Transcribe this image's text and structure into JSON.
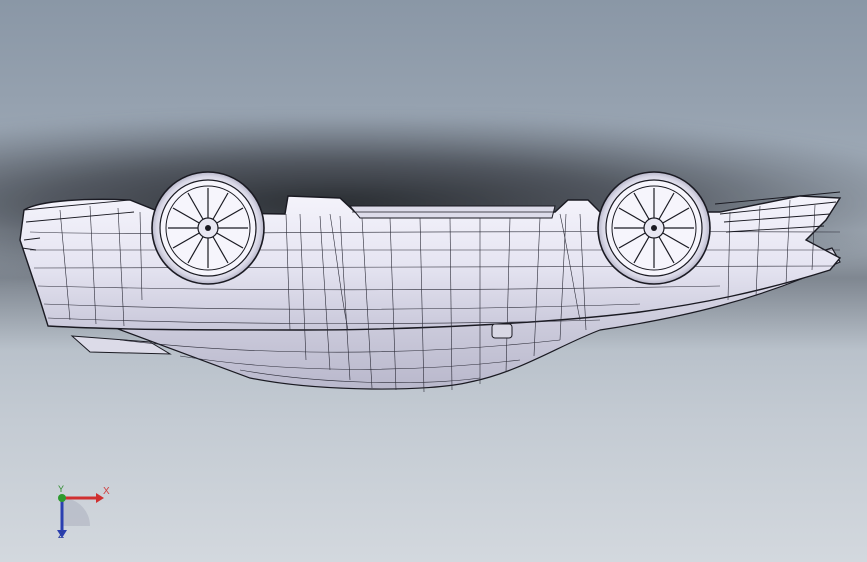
{
  "viewport": {
    "background_top": "#8a97a6",
    "background_bottom": "#d3d8de",
    "model_fill": "#eceaf6",
    "edge_color": "#1a1a22"
  },
  "triad": {
    "x_label": "X",
    "y_label": "Y",
    "z_label": "Z",
    "x_color": "#d03030",
    "y_color": "#2e9a2e",
    "z_color": "#2a3fb0"
  },
  "icons": [
    "coordinate-triad-icon"
  ]
}
